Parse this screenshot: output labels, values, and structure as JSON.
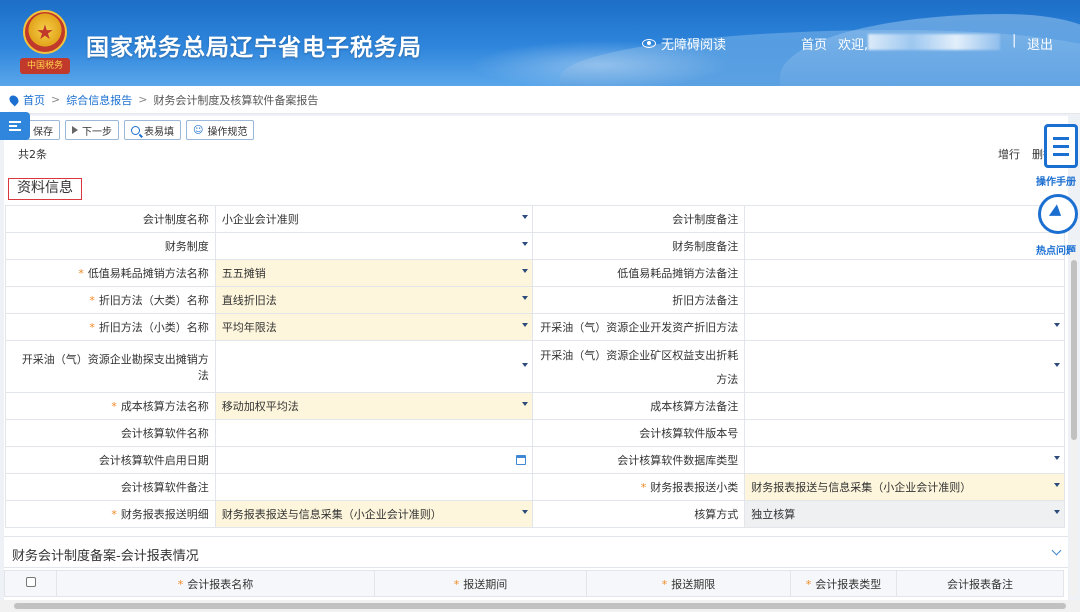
{
  "header": {
    "title": "国家税务总局辽宁省电子税务局",
    "emblem_text": "中国税务",
    "accessibility": "无障碍阅读",
    "home": "首页",
    "welcome": "欢迎,",
    "separator": "|",
    "logout": "退出"
  },
  "breadcrumb": {
    "home": "首页",
    "level1": "综合信息报告",
    "current": "财务会计制度及核算软件备案报告",
    "gt": ">"
  },
  "toolbar": {
    "save": "保存",
    "next": "下一步",
    "form_fill": "表易填",
    "guide": "操作规范"
  },
  "list": {
    "count": "共2条",
    "add_row": "增行",
    "delete_row": "删行"
  },
  "section1": {
    "title": "资料信息",
    "rows": [
      {
        "l1": "会计制度名称",
        "v1": "小企业会计准则",
        "l2": "会计制度备注",
        "v2": ""
      },
      {
        "l1": "财务制度",
        "v1": "",
        "l2": "财务制度备注",
        "v2": ""
      },
      {
        "l1": "低值易耗品摊销方法名称",
        "v1": "五五摊销",
        "l2": "低值易耗品摊销方法备注",
        "v2": ""
      },
      {
        "l1": "折旧方法（大类）名称",
        "v1": "直线折旧法",
        "l2": "折旧方法备注",
        "v2": ""
      },
      {
        "l1": "折旧方法（小类）名称",
        "v1": "平均年限法",
        "l2": "开采油（气）资源企业开发资产折旧方法",
        "v2": ""
      },
      {
        "l1": "开采油（气）资源企业勘探支出摊销方法",
        "v1": "",
        "l2a": "开采油（气）资源企业矿区权益支出折耗",
        "l2b": "方法",
        "v2": ""
      },
      {
        "l1": "成本核算方法名称",
        "v1": "移动加权平均法",
        "l2": "成本核算方法备注",
        "v2": ""
      },
      {
        "l1": "会计核算软件名称",
        "v1": "",
        "l2": "会计核算软件版本号",
        "v2": ""
      },
      {
        "l1": "会计核算软件启用日期",
        "v1": "",
        "l2": "会计核算软件数据库类型",
        "v2": ""
      },
      {
        "l1": "会计核算软件备注",
        "v1": "",
        "l2": "财务报表报送小类",
        "v2": "财务报表报送与信息采集（小企业会计准则）"
      },
      {
        "l1": "财务报表报送明细",
        "v1": "财务报表报送与信息采集（小企业会计准则）",
        "l2": "核算方式",
        "v2": "独立核算"
      }
    ],
    "required_mark": "*"
  },
  "section2": {
    "title": "财务会计制度备案-会计报表情况",
    "columns": [
      "会计报表名称",
      "报送期间",
      "报送期限",
      "会计报表类型",
      "会计报表备注"
    ]
  },
  "float": {
    "manual": "操作手册",
    "hot": "热点问题"
  },
  "colors": {
    "header_blue": "#2f86dc",
    "link_blue": "#1b6fd1",
    "required_orange": "#f08a24",
    "filled_bg": "#fdf6dc",
    "section_border_red": "#d9363e"
  }
}
